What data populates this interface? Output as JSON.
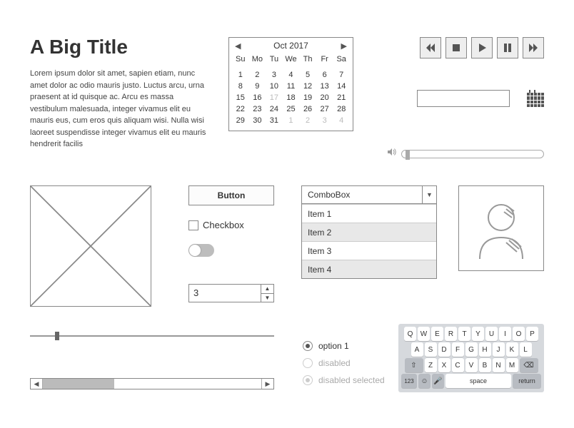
{
  "title": "A Big Title",
  "body": "Lorem ipsum dolor sit amet, sapien etiam, nunc amet dolor ac odio mauris justo. Luctus arcu, urna praesent at id quisque ac. Arcu es massa vestibulum malesuada, integer vivamus elit eu mauris eus, cum eros quis aliquam wisi. Nulla wisi laoreet suspendisse integer vivamus elit eu mauris hendrerit facilis",
  "calendar": {
    "month_label": "Oct  2017",
    "daynames": [
      "Su",
      "Mo",
      "Tu",
      "We",
      "Th",
      "Fr",
      "Sa"
    ],
    "grid": [
      {
        "d": "1"
      },
      {
        "d": "2"
      },
      {
        "d": "3"
      },
      {
        "d": "4"
      },
      {
        "d": "5"
      },
      {
        "d": "6"
      },
      {
        "d": "7"
      },
      {
        "d": "8"
      },
      {
        "d": "9"
      },
      {
        "d": "10"
      },
      {
        "d": "11"
      },
      {
        "d": "12"
      },
      {
        "d": "13"
      },
      {
        "d": "14"
      },
      {
        "d": "15"
      },
      {
        "d": "16"
      },
      {
        "d": "17",
        "dim": true
      },
      {
        "d": "18"
      },
      {
        "d": "19"
      },
      {
        "d": "20"
      },
      {
        "d": "21"
      },
      {
        "d": "22"
      },
      {
        "d": "23"
      },
      {
        "d": "24"
      },
      {
        "d": "25"
      },
      {
        "d": "26"
      },
      {
        "d": "27"
      },
      {
        "d": "28"
      },
      {
        "d": "29"
      },
      {
        "d": "30"
      },
      {
        "d": "31"
      },
      {
        "d": "1",
        "dim": true
      },
      {
        "d": "2",
        "dim": true
      },
      {
        "d": "3",
        "dim": true
      },
      {
        "d": "4",
        "dim": true
      }
    ]
  },
  "button_label": "Button",
  "checkbox_label": "Checkbox",
  "spinner_value": "3",
  "combobox": {
    "label": "ComboBox",
    "items": [
      "Item 1",
      "Item 2",
      "Item 3",
      "Item 4"
    ]
  },
  "radios": {
    "opt1": "option 1",
    "opt2": "disabled",
    "opt3": "disabled selected"
  },
  "keyboard": {
    "row1": [
      "Q",
      "W",
      "E",
      "R",
      "T",
      "Y",
      "U",
      "I",
      "O",
      "P"
    ],
    "row2": [
      "A",
      "S",
      "D",
      "F",
      "G",
      "H",
      "J",
      "K",
      "L"
    ],
    "row3_mid": [
      "Z",
      "X",
      "C",
      "V",
      "B",
      "N",
      "M"
    ],
    "sym": "123",
    "space": "space",
    "ret": "return"
  }
}
